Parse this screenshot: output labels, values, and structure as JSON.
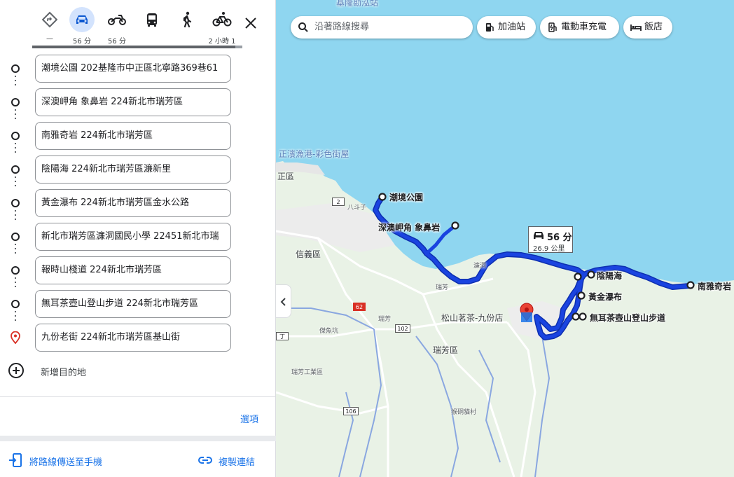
{
  "travel_modes": [
    {
      "name": "best",
      "icon": "directions-diamond-icon",
      "label": "—"
    },
    {
      "name": "driving",
      "icon": "car-icon",
      "label": "56 分",
      "active": true
    },
    {
      "name": "motorcycle",
      "icon": "motorcycle-icon",
      "label": "56 分"
    },
    {
      "name": "transit",
      "icon": "bus-icon",
      "label": ""
    },
    {
      "name": "walking",
      "icon": "walking-icon",
      "label": ""
    },
    {
      "name": "cycling",
      "icon": "bicycle-icon",
      "label": "2 小時 1"
    }
  ],
  "stops": [
    "潮境公園 202基隆市中正區北寧路369巷61",
    "深澳岬角 象鼻岩 224新北市瑞芳區",
    "南雅奇岩 224新北市瑞芳區",
    "陰陽海 224新北市瑞芳區濂新里",
    "黃金瀑布 224新北市瑞芳區金水公路",
    "新北市瑞芳區濂洞國民小學 22451新北市瑞",
    "報時山棧道 224新北市瑞芳區",
    "無耳茶壺山登山步道 224新北市瑞芳區",
    "九份老街 224新北市瑞芳區基山街"
  ],
  "panel": {
    "add_destination": "新增目的地",
    "options": "選項",
    "send_to_phone": "將路線傳送至手機",
    "copy_link": "複製連結"
  },
  "map": {
    "search_placeholder": "沿著路線搜尋",
    "chips": {
      "gas": "加油站",
      "ev": "電動車充電",
      "hotel": "飯店"
    },
    "route_summary": {
      "duration": "56 分",
      "distance": "26.9 公里"
    },
    "markers": {
      "chaojing": "潮境公園",
      "shenao": "深澳岬角 象鼻岩",
      "yinyang": "陰陽海",
      "nanya": "南雅奇岩",
      "golden": "黃金瀑布",
      "teapot": "無耳茶壺山登山步道"
    },
    "places": {
      "zhengbin": "正濱漁港-彩色街屋",
      "zhengqu": "正區",
      "xinyi": "信義區",
      "songshan": "松山茗茶-九份店",
      "ruifang_district": "瑞芳區",
      "ruifang": "瑞芳",
      "ruifang_small": "瑞芳",
      "ruifang_industrial": "瑞芳工業區",
      "badouzi": "八斗子",
      "lianxian": "濂洞",
      "houtong": "猴硐貓村",
      "jieshoukeng": "傑魚坑",
      "top_poi": "基隆勘泓站"
    },
    "roads": {
      "r2": "2",
      "r62": "62",
      "r102": "102",
      "r106": "106",
      "r5": "丁"
    }
  },
  "colors": {
    "sea": "#8fd6f0",
    "land": "#e9f2e6",
    "route": "#1a44e0",
    "accent": "#1a73e8"
  }
}
